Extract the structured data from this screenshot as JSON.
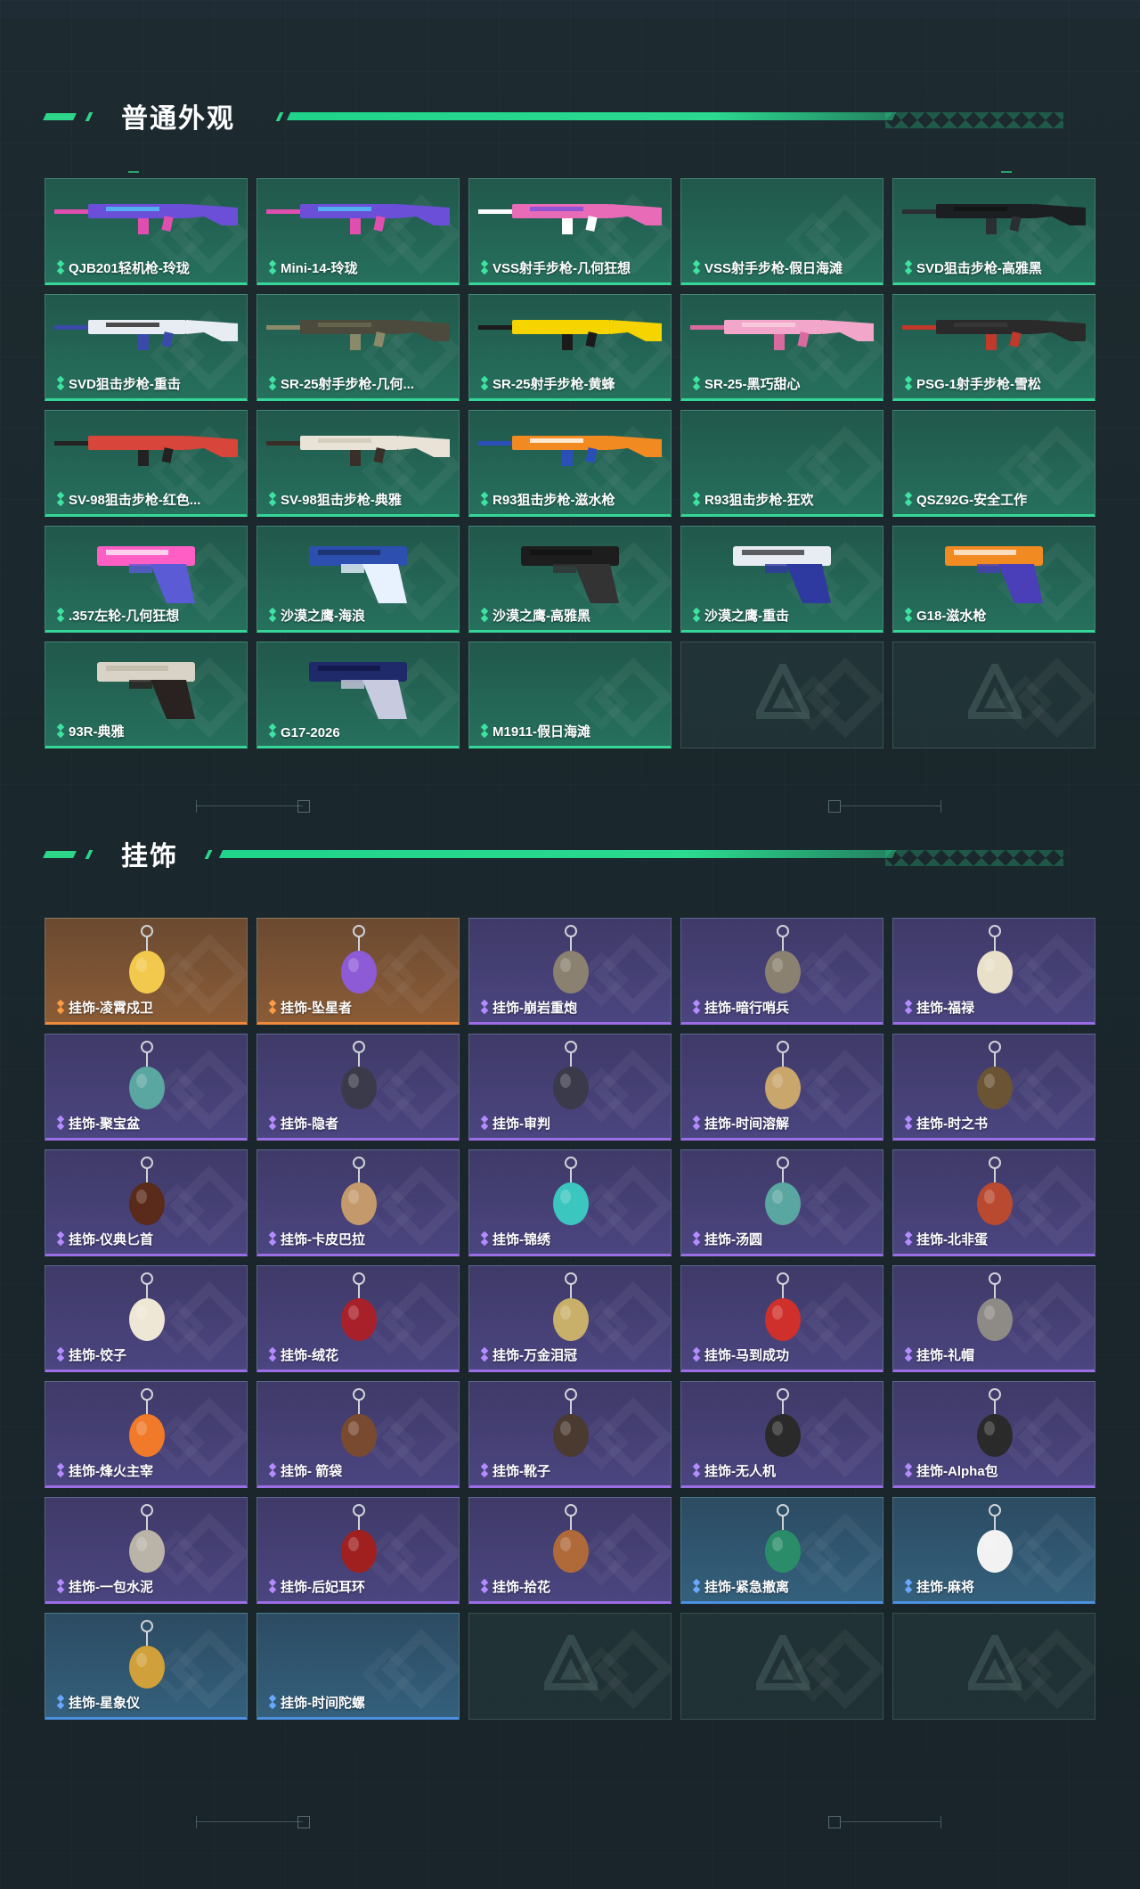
{
  "colors": {
    "accent": "#2ed68a",
    "green_card": "#26705d",
    "orange_card": "#8a5c37",
    "purple_card": "#4b4580",
    "blue_card": "#34607c"
  },
  "skins_section": {
    "title": "普通外观",
    "items": [
      {
        "label": "QJB201轻机枪-玲珑",
        "rarity": "green",
        "image": "rifle-colorful"
      },
      {
        "label": "Mini-14-玲珑",
        "rarity": "green",
        "image": "rifle-colorful"
      },
      {
        "label": "VSS射手步枪-几何狂想",
        "rarity": "green",
        "image": "rifle-pink-geometric"
      },
      {
        "label": "VSS射手步枪-假日海滩",
        "rarity": "green",
        "image": ""
      },
      {
        "label": "SVD狙击步枪-高雅黑",
        "rarity": "green",
        "image": "sniper-black"
      },
      {
        "label": "SVD狙击步枪-重击",
        "rarity": "green",
        "image": "sniper-white-blue"
      },
      {
        "label": "SR-25射手步枪-几何...",
        "rarity": "green",
        "image": "rifle-camo"
      },
      {
        "label": "SR-25射手步枪-黄蜂",
        "rarity": "green",
        "image": "rifle-yellow-black"
      },
      {
        "label": "SR-25-黑巧甜心",
        "rarity": "green",
        "image": "rifle-pink"
      },
      {
        "label": "PSG-1射手步枪-雪松",
        "rarity": "green",
        "image": "sniper-red-dark"
      },
      {
        "label": "SV-98狙击步枪-红色...",
        "rarity": "green",
        "image": "sniper-red"
      },
      {
        "label": "SV-98狙击步枪-典雅",
        "rarity": "green",
        "image": "sniper-white"
      },
      {
        "label": "R93狙击步枪-滋水枪",
        "rarity": "green",
        "image": "sniper-orange-blue"
      },
      {
        "label": "R93狙击步枪-狂欢",
        "rarity": "green",
        "image": ""
      },
      {
        "label": "QSZ92G-安全工作",
        "rarity": "green",
        "image": ""
      },
      {
        "label": ".357左轮-几何狂想",
        "rarity": "green",
        "image": "revolver-pink"
      },
      {
        "label": "沙漠之鹰-海浪",
        "rarity": "green",
        "image": "pistol-blue-wave"
      },
      {
        "label": "沙漠之鹰-高雅黑",
        "rarity": "green",
        "image": "pistol-black"
      },
      {
        "label": "沙漠之鹰-重击",
        "rarity": "green",
        "image": "pistol-white-blue"
      },
      {
        "label": "G18-滋水枪",
        "rarity": "green",
        "image": "pistol-orange-blue"
      },
      {
        "label": "93R-典雅",
        "rarity": "green",
        "image": "pistol-white"
      },
      {
        "label": "G17-2026",
        "rarity": "green",
        "image": "pistol-navy"
      },
      {
        "label": "M1911-假日海滩",
        "rarity": "green",
        "image": ""
      },
      {
        "label": "",
        "rarity": "empty",
        "image": ""
      },
      {
        "label": "",
        "rarity": "empty",
        "image": ""
      }
    ]
  },
  "charms_section": {
    "title": "挂饰",
    "items": [
      {
        "label": "挂饰-凌霄戍卫",
        "rarity": "orange",
        "image": "charm-chick"
      },
      {
        "label": "挂饰-坠星者",
        "rarity": "orange",
        "image": "charm-crystal"
      },
      {
        "label": "挂饰-崩岩重炮",
        "rarity": "purple",
        "image": "charm-figure"
      },
      {
        "label": "挂饰-暗行哨兵",
        "rarity": "purple",
        "image": "charm-figure"
      },
      {
        "label": "挂饰-福禄",
        "rarity": "purple",
        "image": "charm-gourd"
      },
      {
        "label": "挂饰-聚宝盆",
        "rarity": "purple",
        "image": "charm-bowl"
      },
      {
        "label": "挂饰-隐者",
        "rarity": "purple",
        "image": "charm-card"
      },
      {
        "label": "挂饰-审判",
        "rarity": "purple",
        "image": "charm-card"
      },
      {
        "label": "挂饰-时间溶解",
        "rarity": "purple",
        "image": "charm-clock"
      },
      {
        "label": "挂饰-时之书",
        "rarity": "purple",
        "image": "charm-book"
      },
      {
        "label": "挂饰-仪典匕首",
        "rarity": "purple",
        "image": "charm-dagger"
      },
      {
        "label": "挂饰-卡皮巴拉",
        "rarity": "purple",
        "image": "charm-capybara"
      },
      {
        "label": "挂饰-锦绣",
        "rarity": "purple",
        "image": "charm-butterfly"
      },
      {
        "label": "挂饰-汤圆",
        "rarity": "purple",
        "image": "charm-bowl"
      },
      {
        "label": "挂饰-北非蛋",
        "rarity": "purple",
        "image": "charm-pan"
      },
      {
        "label": "挂饰-饺子",
        "rarity": "purple",
        "image": "charm-dumpling"
      },
      {
        "label": "挂饰-绒花",
        "rarity": "purple",
        "image": "charm-flower"
      },
      {
        "label": "挂饰-万金泪冠",
        "rarity": "purple",
        "image": "charm-crown"
      },
      {
        "label": "挂饰-马到成功",
        "rarity": "purple",
        "image": "charm-horse"
      },
      {
        "label": "挂饰-礼帽",
        "rarity": "purple",
        "image": "charm-hat"
      },
      {
        "label": "挂饰-烽火主宰",
        "rarity": "purple",
        "image": "charm-box"
      },
      {
        "label": "挂饰- 箭袋",
        "rarity": "purple",
        "image": "charm-quiver"
      },
      {
        "label": "挂饰-靴子",
        "rarity": "purple",
        "image": "charm-boot"
      },
      {
        "label": "挂饰-无人机",
        "rarity": "purple",
        "image": "charm-drone"
      },
      {
        "label": "挂饰-Alpha包",
        "rarity": "purple",
        "image": "charm-bag"
      },
      {
        "label": "挂饰-一包水泥",
        "rarity": "purple",
        "image": "charm-sack"
      },
      {
        "label": "挂饰-后妃耳环",
        "rarity": "purple",
        "image": "charm-earring"
      },
      {
        "label": "挂饰-拾花",
        "rarity": "purple",
        "image": "charm-frame"
      },
      {
        "label": "挂饰-紧急撤离",
        "rarity": "blue",
        "image": "charm-sign"
      },
      {
        "label": "挂饰-麻将",
        "rarity": "blue",
        "image": "charm-mahjong"
      },
      {
        "label": "挂饰-星象仪",
        "rarity": "blue",
        "image": "charm-astrolabe"
      },
      {
        "label": "挂饰-时间陀螺",
        "rarity": "blue",
        "image": ""
      },
      {
        "label": "",
        "rarity": "empty",
        "image": ""
      },
      {
        "label": "",
        "rarity": "empty",
        "image": ""
      },
      {
        "label": "",
        "rarity": "empty",
        "image": ""
      }
    ]
  }
}
